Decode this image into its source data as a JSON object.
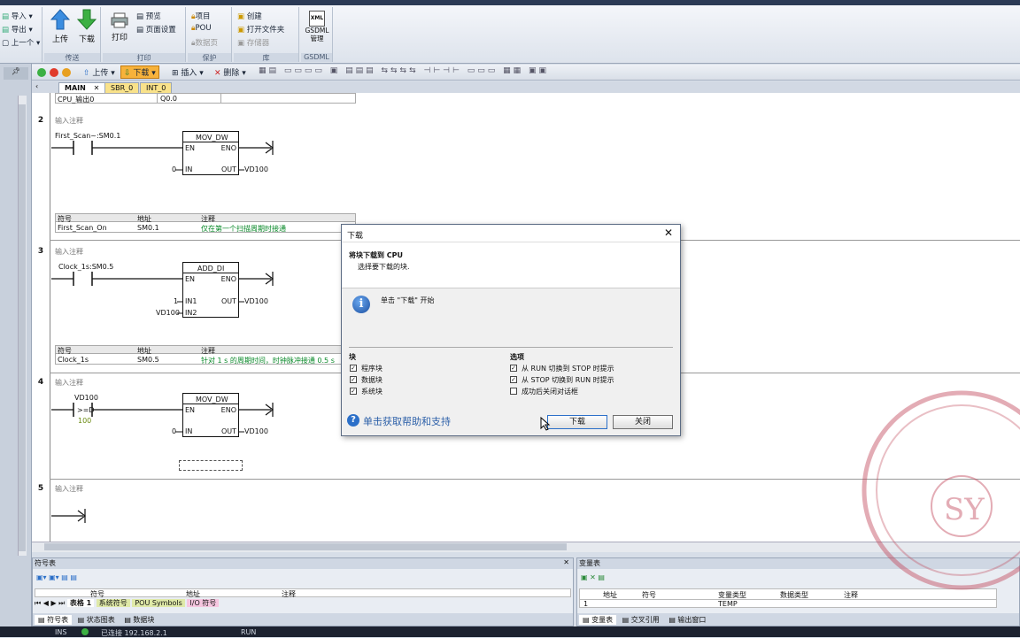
{
  "ribbon": {
    "import": "导入",
    "export": "导出",
    "previous": "上一个",
    "upload": "上传",
    "download": "下载",
    "group_transfer": "传送",
    "print": "打印",
    "preview": "预览",
    "page_setup": "页面设置",
    "group_print": "打印",
    "project": "项目",
    "pou": "POU",
    "data_page": "数据页",
    "group_protect": "保护",
    "create": "创建",
    "open_folder": "打开文件夹",
    "memory_card": "存储器",
    "group_library": "库",
    "xml": "XML",
    "gsdml_manage": "GSDML管理",
    "group_gsdml": "GSDML"
  },
  "toolbar": {
    "upload": "上传",
    "download": "下载",
    "insert": "插入",
    "delete": "删除"
  },
  "tabs": [
    "MAIN",
    "SBR_0",
    "INT_0"
  ],
  "networks": {
    "n1": {
      "symbol": "CPU_输出0",
      "address": "Q0.0"
    },
    "n2": {
      "num": "2",
      "comment": "输入注释",
      "contact": "First_Scan~:SM0.1",
      "block": "MOV_DW",
      "en": "EN",
      "eno": "ENO",
      "in": "IN",
      "out": "OUT",
      "in_val": "0",
      "out_val": "VD100",
      "tbl_h1": "符号",
      "tbl_h2": "地址",
      "tbl_h3": "注释",
      "sym": "First_Scan_On",
      "addr": "SM0.1",
      "note": "仅在第一个扫描周期时接通"
    },
    "n3": {
      "num": "3",
      "comment": "输入注释",
      "contact": "Clock_1s:SM0.5",
      "block": "ADD_DI",
      "en": "EN",
      "eno": "ENO",
      "in1": "IN1",
      "in2": "IN2",
      "out": "OUT",
      "in1_val": "1",
      "in2_val": "VD100",
      "out_val": "VD100",
      "tbl_h1": "符号",
      "tbl_h2": "地址",
      "tbl_h3": "注释",
      "sym": "Clock_1s",
      "addr": "SM0.5",
      "note": "针对 1 s 的周期时间，时钟脉冲接通 0.5 s"
    },
    "n4": {
      "num": "4",
      "comment": "输入注释",
      "contact_top": "VD100",
      "contact_op": ">=D",
      "contact_bottom": "100",
      "block": "MOV_DW",
      "en": "EN",
      "eno": "ENO",
      "in": "IN",
      "out": "OUT",
      "in_val": "0",
      "out_val": "VD100"
    },
    "n5": {
      "num": "5",
      "comment": "输入注释"
    }
  },
  "dialog": {
    "title": "下载",
    "heading": "将块下载到 CPU",
    "subheading": "选择要下载的块.",
    "info": "单击 \"下载\" 开始",
    "blocks_label": "块",
    "block_items": [
      "程序块",
      "数据块",
      "系统块"
    ],
    "options_label": "选项",
    "option_items": [
      "从 RUN 切换到 STOP 时提示",
      "从 STOP 切换到 RUN 时提示",
      "成功后关闭对话框"
    ],
    "option_checked": [
      true,
      true,
      false
    ],
    "help": "单击获取帮助和支持",
    "download_btn": "下载",
    "close_btn": "关闭"
  },
  "symbol_panel": {
    "title": "符号表",
    "col_symbol": "符号",
    "col_address": "地址",
    "col_note": "注释",
    "sheet_tabs": [
      "表格 1",
      "系统符号",
      "POU Symbols",
      "I/O 符号"
    ],
    "bottom_tabs": [
      "符号表",
      "状态图表",
      "数据块"
    ]
  },
  "var_panel": {
    "title": "变量表",
    "cols": [
      "地址",
      "符号",
      "变量类型",
      "数据类型",
      "注释"
    ],
    "row_num": "1",
    "row_type": "TEMP",
    "bottom_tabs": [
      "变量表",
      "交叉引用",
      "输出窗口"
    ]
  },
  "status": {
    "mode": "INS",
    "connection": "已连接 192.168.2.1",
    "run": "RUN"
  },
  "colors": {
    "accent": "#2b5fa8",
    "comment_green": "#0a8a2a",
    "download_highlight": "#f7b23b"
  }
}
